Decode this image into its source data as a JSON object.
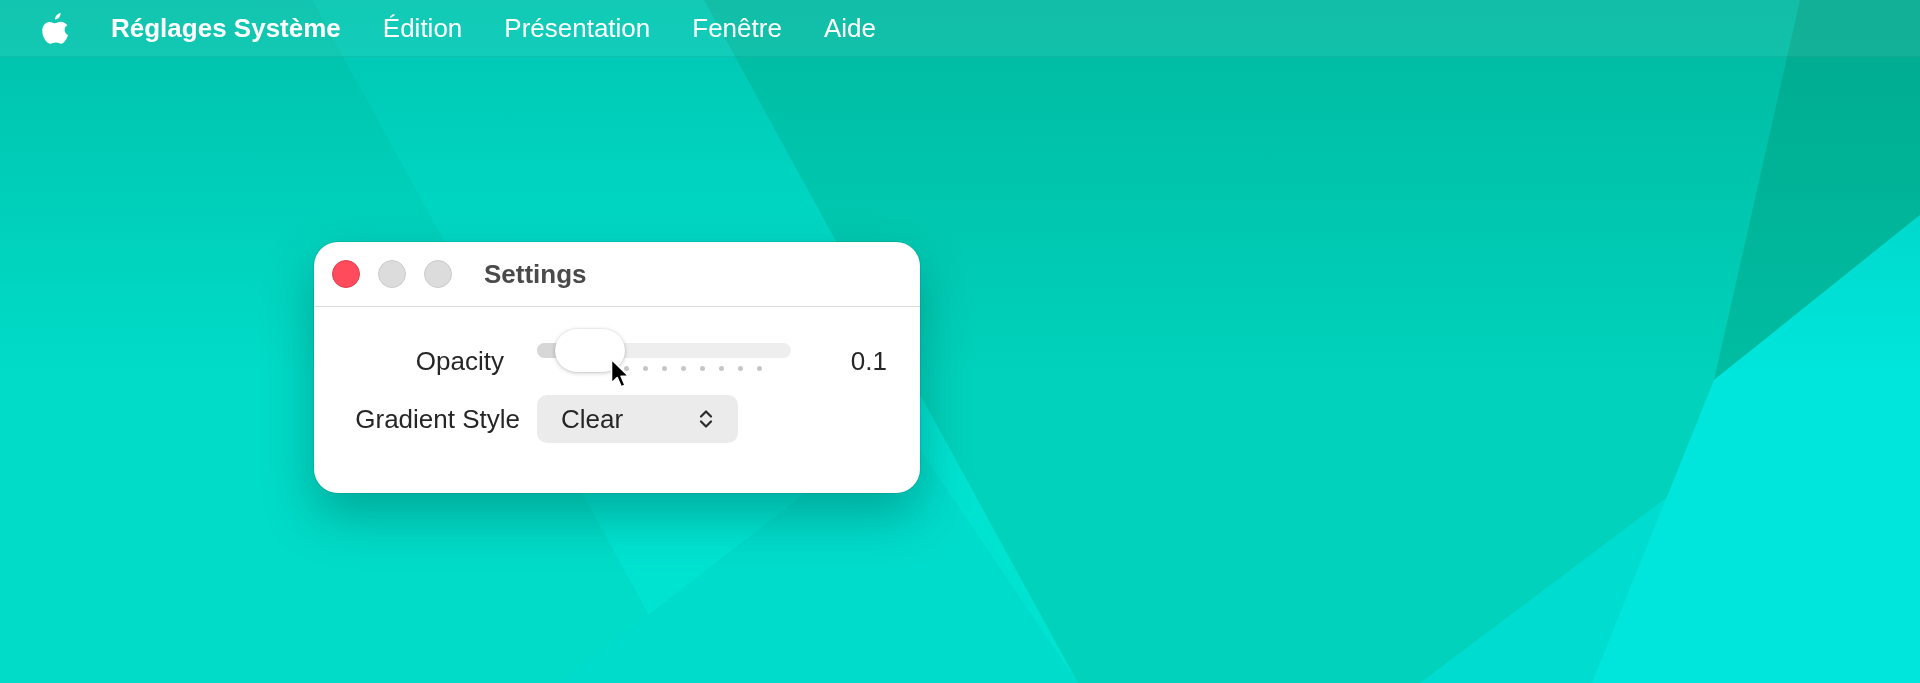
{
  "menu_bar": {
    "items": [
      {
        "label": "Réglages Système",
        "kind": "app"
      },
      {
        "label": "Édition",
        "kind": "menu"
      },
      {
        "label": "Présentation",
        "kind": "menu"
      },
      {
        "label": "Fenêtre",
        "kind": "menu"
      },
      {
        "label": "Aide",
        "kind": "menu"
      }
    ]
  },
  "window": {
    "title": "Settings",
    "buttons": [
      {
        "kind": "close",
        "disabled": false
      },
      {
        "kind": "minimize",
        "disabled": true
      },
      {
        "kind": "zoom",
        "disabled": true
      }
    ],
    "rows": [
      {
        "kind": "slider",
        "label": "Opacity",
        "level": 0.1,
        "reading": "0.1"
      },
      {
        "kind": "popup",
        "label": "Gradient Style",
        "value": "Clear"
      }
    ]
  }
}
